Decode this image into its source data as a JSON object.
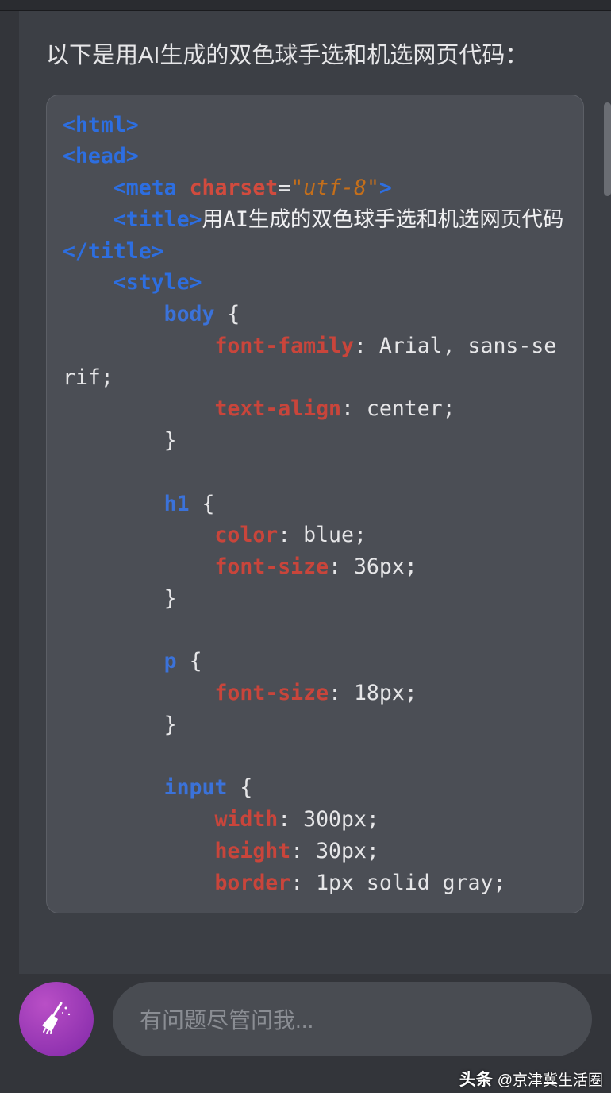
{
  "intro_text": "以下是用AI生成的双色球手选和机选网页代码：",
  "code": {
    "open_html": "<html>",
    "open_head": "<head>",
    "meta_open": "<meta",
    "meta_attr": "charset",
    "meta_eq": "=",
    "meta_val": "\"utf-8\"",
    "meta_close": ">",
    "title_open": "<title>",
    "title_text": "用AI生成的双色球手选和机选网页代码",
    "title_close": "</title>",
    "style_open": "<style>",
    "sel_body": "body",
    "brace_open": " {",
    "prop_ff": "font-family",
    "val_ff": ": Arial, sans-serif;",
    "prop_ta": "text-align",
    "val_ta": ": center;",
    "brace_close": "}",
    "sel_h1": "h1",
    "prop_color": "color",
    "val_color": ": blue;",
    "prop_fs": "font-size",
    "val_fs36": ": 36px;",
    "sel_p": "p",
    "val_fs18": ": 18px;",
    "sel_input": "input",
    "prop_w": "width",
    "val_w": ": 300px;",
    "prop_h": "height",
    "val_h": ": 30px;",
    "prop_border": "border",
    "val_border": ": 1px solid gray;"
  },
  "input_placeholder": "有问题尽管问我...",
  "footer": {
    "brand": "头条",
    "handle": "@京津冀生活圈"
  }
}
